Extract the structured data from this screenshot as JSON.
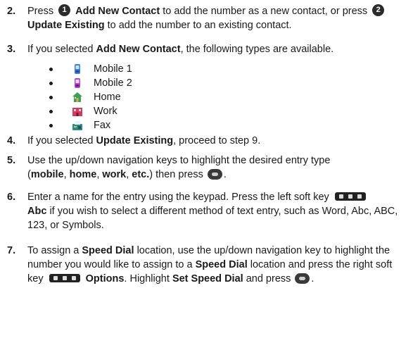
{
  "steps": {
    "s2": {
      "num": "2.",
      "t1": "Press",
      "key1": "1",
      "b1": "Add New Contact",
      "t2": "to add the number as a new contact, or press",
      "key2": "2",
      "b2": "Update Existing",
      "t3": "to add the number to an existing contact."
    },
    "s3": {
      "num": "3.",
      "t1": "If you selected",
      "b1": "Add New Contact",
      "t2": ", the following types are available.",
      "types": [
        {
          "label": "Mobile 1",
          "icon": "mobile-phone-icon",
          "color": "#3a7fd8"
        },
        {
          "label": "Mobile 2",
          "icon": "mobile-phone-icon",
          "color": "#b048c8"
        },
        {
          "label": "Home",
          "icon": "home-icon",
          "color": "#3aa05a"
        },
        {
          "label": "Work",
          "icon": "work-building-icon",
          "color": "#d23c5c"
        },
        {
          "label": "Fax",
          "icon": "fax-icon",
          "color": "#2c8a8a"
        }
      ]
    },
    "s4": {
      "num": "4.",
      "t1": "If you selected",
      "b1": "Update Existing",
      "t2": ", proceed to step 9."
    },
    "s5": {
      "num": "5.",
      "t1": "Use the up/down navigation keys to highlight the desired entry type",
      "t2": "(",
      "b1": "mobile",
      "t3": ",",
      "b2": "home",
      "t4": ",",
      "b3": "work",
      "t5": ",",
      "b4": "etc.",
      "t6": ") then press"
    },
    "s6": {
      "num": "6.",
      "t1": "Enter a name for the entry using the keypad. Press the left soft key",
      "b1": "Abc",
      "t2": "if you wish to select a different method of text entry, such as Word, Abc, ABC, 123, or Symbols."
    },
    "s7": {
      "num": "7.",
      "t1": "To assign a",
      "b1": "Speed Dial",
      "t2": "location, use the up/down navigation key to highlight the number you would like to assign to a",
      "b2": "Speed Dial",
      "t3": "location and press the right soft key",
      "b3": "Options",
      "t4": ". Highlight",
      "b4": "Set Speed Dial",
      "t5": "and press"
    }
  }
}
